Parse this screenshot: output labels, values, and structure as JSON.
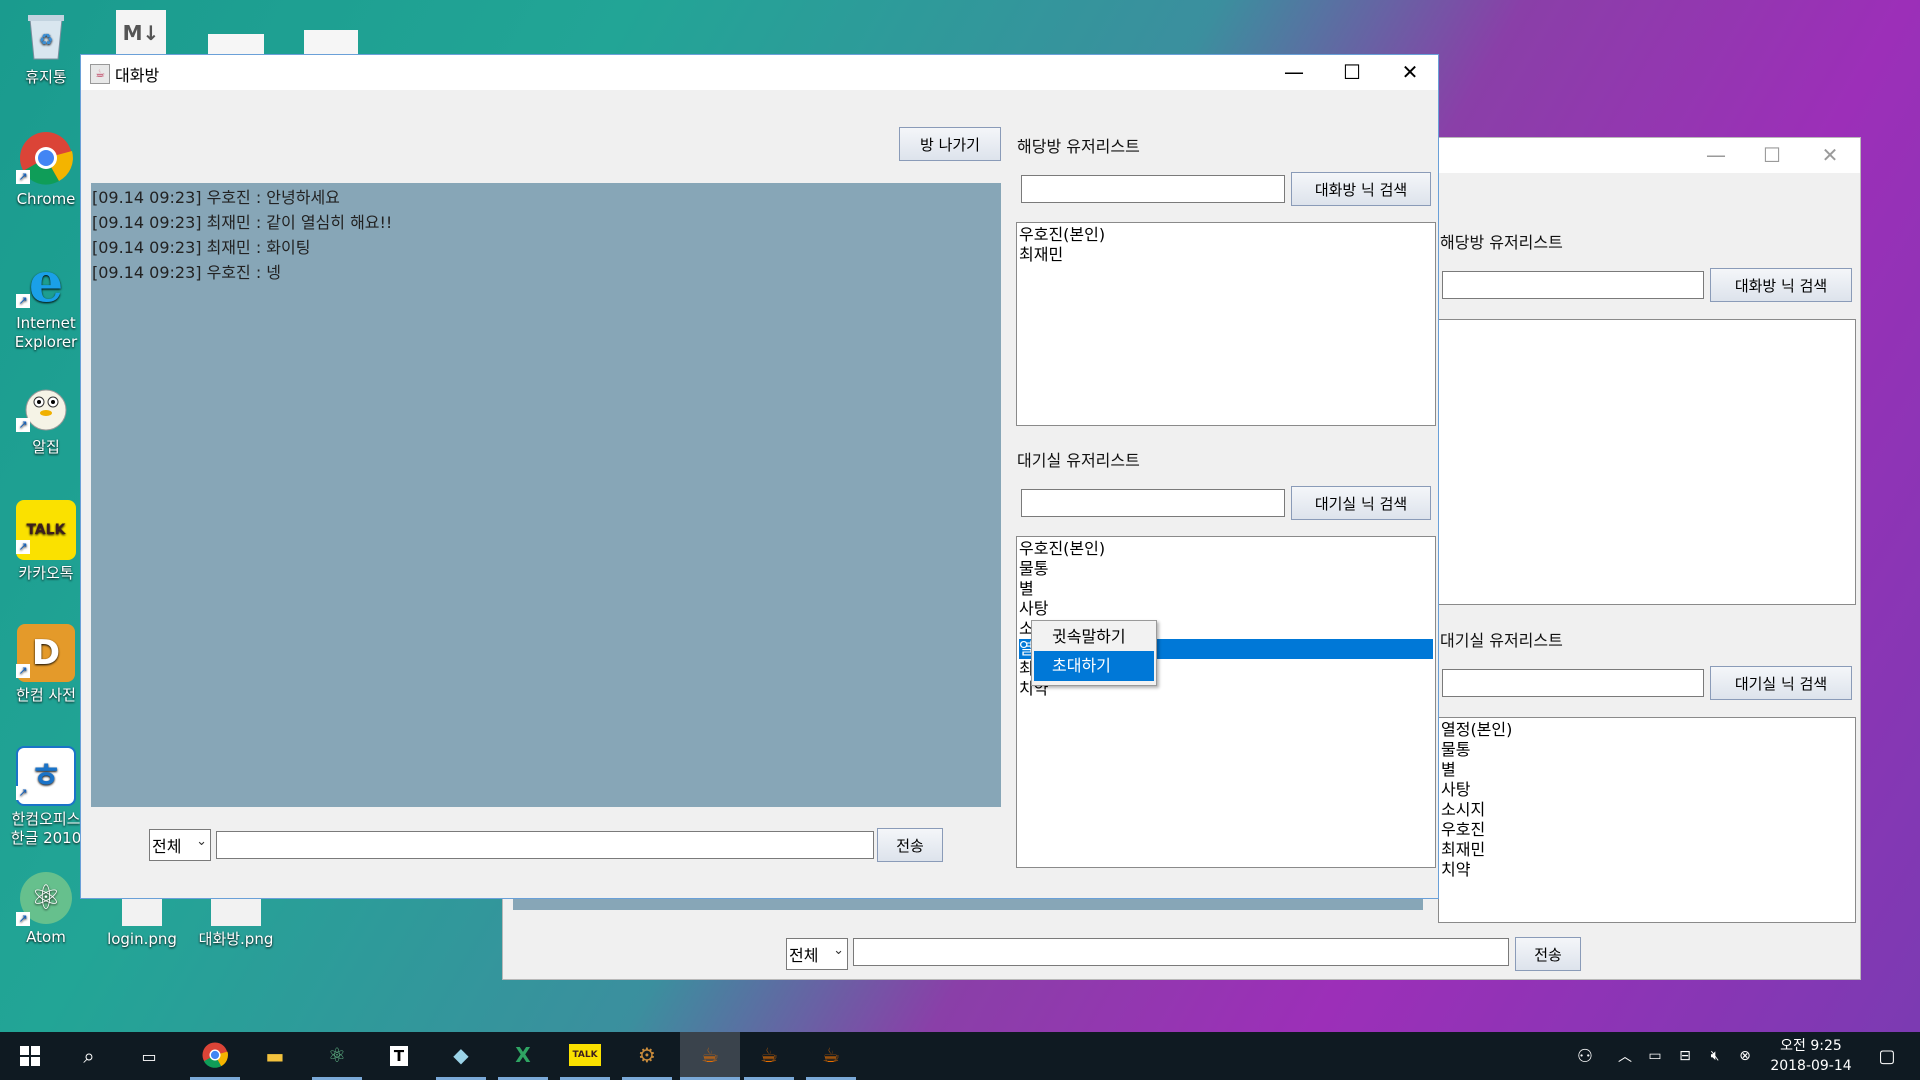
{
  "desktop": {
    "icons": [
      {
        "label": "휴지통",
        "icon": "recycle-bin-icon"
      },
      {
        "label": "Chrome",
        "icon": "chrome-icon"
      },
      {
        "label": "Internet Explorer",
        "icon": "ie-icon"
      },
      {
        "label": "알집",
        "icon": "alzip-icon"
      },
      {
        "label": "카카오톡",
        "icon": "kakaotalk-icon"
      },
      {
        "label": "한컴 사전",
        "icon": "hancom-dict-icon"
      },
      {
        "label": "한컴오피스 한글 2010",
        "icon": "hangul-icon"
      },
      {
        "label": "Atom",
        "icon": "atom-icon"
      },
      {
        "label": "login.png",
        "icon": "image-file-icon"
      },
      {
        "label": "대화방.png",
        "icon": "image-file-icon"
      }
    ],
    "md_icon_text": "M↓"
  },
  "main_window": {
    "title": "대화방",
    "exit_button": "방 나가기",
    "room_users_label": "해당방 유저리스트",
    "room_search_button": "대화방 닉 검색",
    "room_search_value": "",
    "room_users": [
      "우호진(본인)",
      "최재민"
    ],
    "lobby_users_label": "대기실 유저리스트",
    "lobby_search_button": "대기실 닉 검색",
    "lobby_search_value": "",
    "lobby_users": [
      "우호진(본인)",
      "물통",
      "별",
      "사탕",
      "소",
      "열",
      "최",
      "치약"
    ],
    "chat_messages": [
      "[09.14 09:23] 우호진 : 안녕하세요",
      "[09.14 09:23] 최재민 : 같이 열심히 해요!!",
      "[09.14 09:23] 최재민 : 화이팅",
      "[09.14 09:23] 우호진 : 넹"
    ],
    "target_select": "전체",
    "message_input": "",
    "send_button": "전송",
    "context_menu": {
      "items": [
        "귓속말하기",
        "초대하기"
      ],
      "highlighted": "초대하기"
    }
  },
  "back_window": {
    "room_users_label": "해당방 유저리스트",
    "room_search_button": "대화방 닉 검색",
    "lobby_users_label": "대기실 유저리스트",
    "lobby_search_button": "대기실 닉 검색",
    "lobby_users": [
      "열정(본인)",
      "물통",
      "별",
      "사탕",
      "소시지",
      "우호진",
      "최재민",
      "치약"
    ],
    "target_select": "전체",
    "send_button": "전송"
  },
  "taskbar": {
    "time": "오전 9:25",
    "date": "2018-09-14",
    "apps": [
      "start-icon",
      "search-icon",
      "task-view-icon",
      "chrome-icon",
      "file-explorer-icon",
      "atom-icon",
      "typora-icon",
      "notepad-icon",
      "excel-icon",
      "kakaotalk-icon",
      "settings-gear-icon",
      "java-icon",
      "java-icon",
      "java-icon"
    ]
  },
  "colors": {
    "selection": "#0078d7",
    "chat_bg": "#87a6b7",
    "taskbar": "#0f1a22"
  }
}
